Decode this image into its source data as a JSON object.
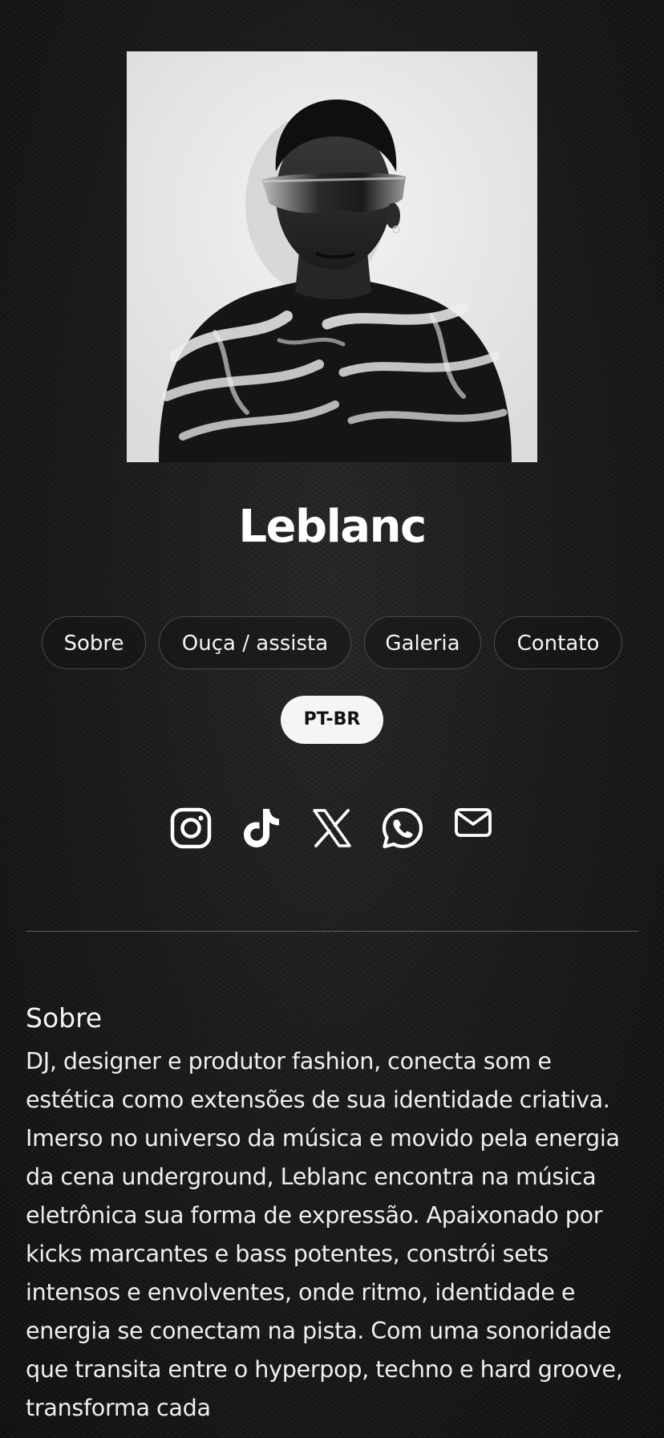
{
  "profile": {
    "name": "Leblanc"
  },
  "nav": {
    "items": [
      {
        "label": "Sobre"
      },
      {
        "label": "Ouça / assista"
      },
      {
        "label": "Galeria"
      },
      {
        "label": "Contato"
      }
    ],
    "language": "PT-BR"
  },
  "socials": [
    {
      "icon": "instagram-icon"
    },
    {
      "icon": "tiktok-icon"
    },
    {
      "icon": "x-icon"
    },
    {
      "icon": "whatsapp-icon"
    },
    {
      "icon": "email-icon"
    }
  ],
  "about": {
    "title": "Sobre",
    "text": "DJ, designer e produtor fashion, conecta som e estética como extensões de sua identidade criativa. Imerso no universo da música e movido pela energia da cena underground, Leblanc encontra na música eletrônica sua forma de expressão. Apaixonado por kicks marcantes e bass potentes, constrói sets intensos e envolventes, onde ritmo, identidade e energia se conectam na pista. Com uma sonoridade que transita entre o hyperpop, techno e hard groove, transforma cada"
  },
  "theme": {
    "background": "#141414",
    "text": "#f2f2f2",
    "pill_border": "#4a4a4a",
    "lang_pill_bg": "#f5f5f5",
    "lang_pill_text": "#111111",
    "divider": "#5e5e5e"
  }
}
